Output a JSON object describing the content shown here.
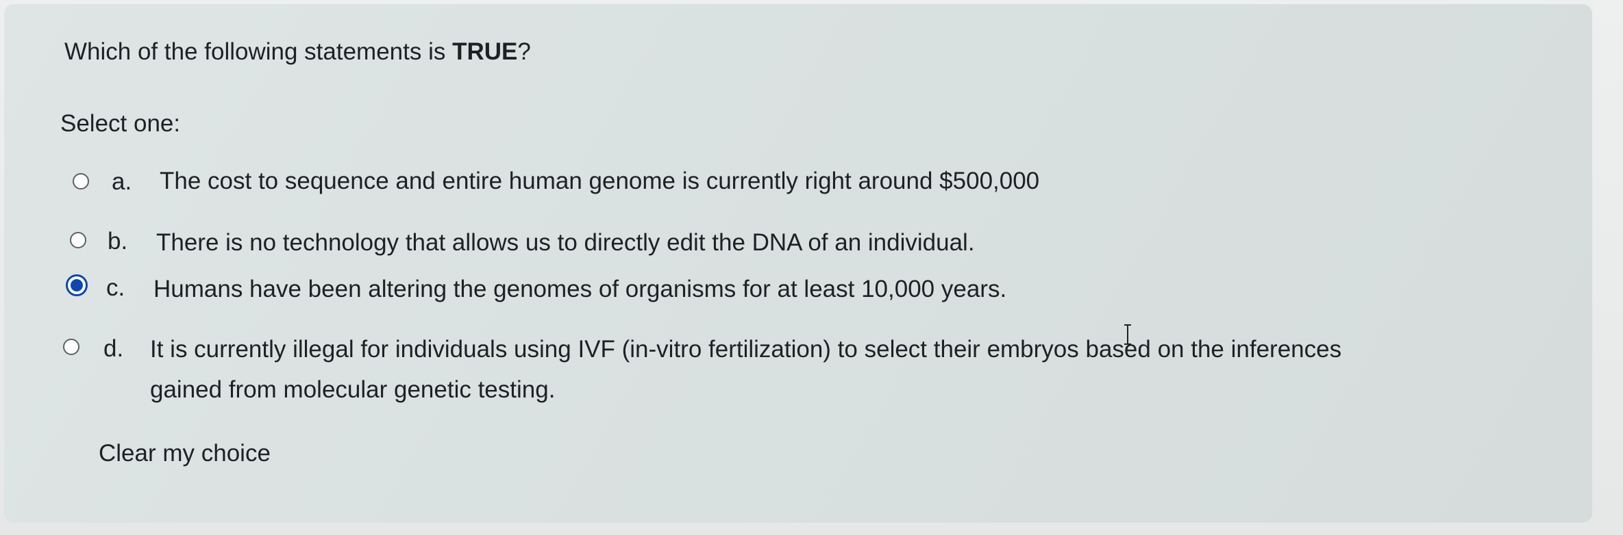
{
  "question": {
    "text_before": "Which of the following statements is ",
    "text_bold": "TRUE",
    "text_after": "?"
  },
  "prompt": "Select one:",
  "options": [
    {
      "letter": "a.",
      "text": "The cost to sequence and entire human genome is currently right around $500,000",
      "selected": false
    },
    {
      "letter": "b.",
      "text": "There is no technology that allows us to directly edit the DNA of an individual.",
      "selected": false
    },
    {
      "letter": "c.",
      "text": "Humans have been altering the genomes of organisms for at least 10,000 years.",
      "selected": true
    },
    {
      "letter": "d.",
      "text_line1": "It is currently illegal for individuals using IVF (in-vitro fertilization) to select their embryos based on the inferences",
      "text_line2": "gained from molecular genetic testing.",
      "selected": false
    }
  ],
  "clear_choice_label": "Clear my choice",
  "colors": {
    "accent": "#0f47ad",
    "card_background": "#dce2e2",
    "text": "#1d2125"
  },
  "icons": {
    "cursor": "text-cursor-icon"
  }
}
